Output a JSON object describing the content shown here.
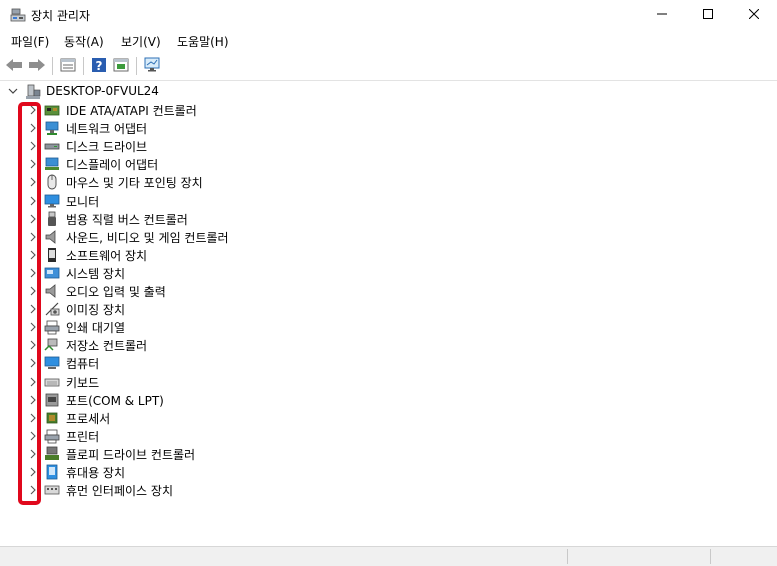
{
  "window": {
    "title": "장치 관리자",
    "icon": "device-manager-icon",
    "controls": [
      "minimize-icon",
      "maximize-icon",
      "close-icon"
    ]
  },
  "menu": {
    "items": [
      "파일(F)",
      "동작(A)",
      "보기(V)",
      "도움말(H)"
    ]
  },
  "toolbar": {
    "buttons": [
      "back-arrow-icon",
      "forward-arrow-icon",
      "properties-icon",
      "help-icon",
      "action-view-icon",
      "monitor-scan-icon"
    ]
  },
  "tree": {
    "root": {
      "label": "DESKTOP-0FVUL24",
      "expanded": true,
      "icon": "computer-icon"
    },
    "categories": [
      {
        "label": "IDE ATA/ATAPI 컨트롤러",
        "icon": "ide-controller-icon"
      },
      {
        "label": "네트워크 어댑터",
        "icon": "network-adapter-icon"
      },
      {
        "label": "디스크 드라이브",
        "icon": "disk-drive-icon"
      },
      {
        "label": "디스플레이 어댑터",
        "icon": "display-adapter-icon"
      },
      {
        "label": "마우스 및 기타 포인팅 장치",
        "icon": "mouse-icon"
      },
      {
        "label": "모니터",
        "icon": "monitor-icon"
      },
      {
        "label": "범용 직렬 버스 컨트롤러",
        "icon": "usb-icon"
      },
      {
        "label": "사운드, 비디오 및 게임 컨트롤러",
        "icon": "speaker-icon"
      },
      {
        "label": "소프트웨어 장치",
        "icon": "software-device-icon"
      },
      {
        "label": "시스템 장치",
        "icon": "system-device-icon"
      },
      {
        "label": "오디오 입력 및 출력",
        "icon": "audio-io-icon"
      },
      {
        "label": "이미징 장치",
        "icon": "camera-icon"
      },
      {
        "label": "인쇄 대기열",
        "icon": "print-queue-icon"
      },
      {
        "label": "저장소 컨트롤러",
        "icon": "storage-controller-icon"
      },
      {
        "label": "컴퓨터",
        "icon": "computer-icon"
      },
      {
        "label": "키보드",
        "icon": "keyboard-icon"
      },
      {
        "label": "포트(COM & LPT)",
        "icon": "port-icon"
      },
      {
        "label": "프로세서",
        "icon": "processor-icon"
      },
      {
        "label": "프린터",
        "icon": "printer-icon"
      },
      {
        "label": "플로피 드라이브 컨트롤러",
        "icon": "floppy-controller-icon"
      },
      {
        "label": "휴대용 장치",
        "icon": "portable-device-icon"
      },
      {
        "label": "휴먼 인터페이스 장치",
        "icon": "hid-icon"
      }
    ]
  },
  "annotation": {
    "color": "#e0081c"
  }
}
